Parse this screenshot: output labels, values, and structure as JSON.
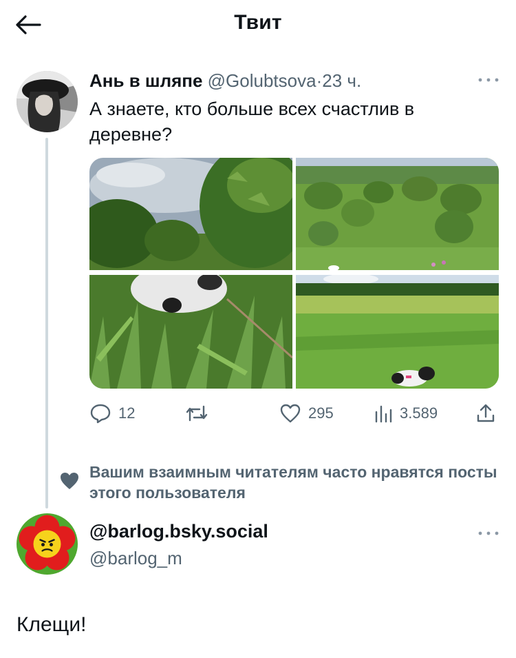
{
  "header": {
    "title": "Твит",
    "back_icon": "arrow-left-icon"
  },
  "tweet": {
    "author_name": "Ань в шляпе",
    "author_handle": "@Golubtsova",
    "separator": "·",
    "time": "23 ч.",
    "text": "А знаете, кто больше всех счастлив в деревне?",
    "media_count": 4,
    "actions": {
      "replies": "12",
      "retweets": "",
      "likes": "295",
      "views": "3.589"
    }
  },
  "recommendation": {
    "text": "Вашим взаимным читателям часто нравятся посты этого пользователя",
    "icon": "heart-icon"
  },
  "suggested_user": {
    "name": "@barlog.bsky.social",
    "handle": "@barlog_m"
  },
  "reply": {
    "text": "Клещи!"
  },
  "colors": {
    "text": "#0f1419",
    "secondary": "#536471",
    "thread_line": "#cfd9de",
    "background": "#ffffff"
  }
}
